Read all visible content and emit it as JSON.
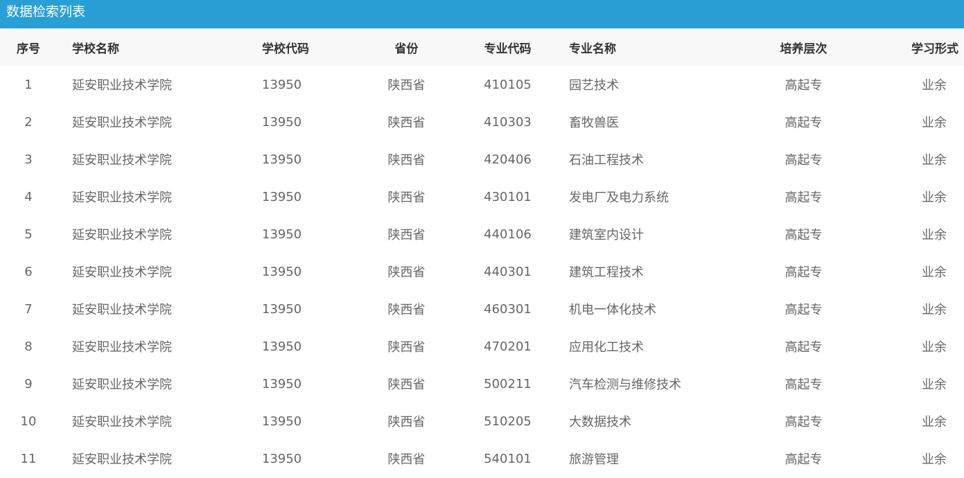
{
  "panel": {
    "title": "数据检索列表"
  },
  "columns": {
    "index": "序号",
    "school_name": "学校名称",
    "school_code": "学校代码",
    "province": "省份",
    "major_code": "专业代码",
    "major_name": "专业名称",
    "level": "培养层次",
    "study_form": "学习形式"
  },
  "rows": [
    {
      "index": "1",
      "school_name": "延安职业技术学院",
      "school_code": "13950",
      "province": "陕西省",
      "major_code": "410105",
      "major_name": "园艺技术",
      "level": "高起专",
      "study_form": "业余"
    },
    {
      "index": "2",
      "school_name": "延安职业技术学院",
      "school_code": "13950",
      "province": "陕西省",
      "major_code": "410303",
      "major_name": "畜牧兽医",
      "level": "高起专",
      "study_form": "业余"
    },
    {
      "index": "3",
      "school_name": "延安职业技术学院",
      "school_code": "13950",
      "province": "陕西省",
      "major_code": "420406",
      "major_name": "石油工程技术",
      "level": "高起专",
      "study_form": "业余"
    },
    {
      "index": "4",
      "school_name": "延安职业技术学院",
      "school_code": "13950",
      "province": "陕西省",
      "major_code": "430101",
      "major_name": "发电厂及电力系统",
      "level": "高起专",
      "study_form": "业余"
    },
    {
      "index": "5",
      "school_name": "延安职业技术学院",
      "school_code": "13950",
      "province": "陕西省",
      "major_code": "440106",
      "major_name": "建筑室内设计",
      "level": "高起专",
      "study_form": "业余"
    },
    {
      "index": "6",
      "school_name": "延安职业技术学院",
      "school_code": "13950",
      "province": "陕西省",
      "major_code": "440301",
      "major_name": "建筑工程技术",
      "level": "高起专",
      "study_form": "业余"
    },
    {
      "index": "7",
      "school_name": "延安职业技术学院",
      "school_code": "13950",
      "province": "陕西省",
      "major_code": "460301",
      "major_name": "机电一体化技术",
      "level": "高起专",
      "study_form": "业余"
    },
    {
      "index": "8",
      "school_name": "延安职业技术学院",
      "school_code": "13950",
      "province": "陕西省",
      "major_code": "470201",
      "major_name": "应用化工技术",
      "level": "高起专",
      "study_form": "业余"
    },
    {
      "index": "9",
      "school_name": "延安职业技术学院",
      "school_code": "13950",
      "province": "陕西省",
      "major_code": "500211",
      "major_name": "汽车检测与维修技术",
      "level": "高起专",
      "study_form": "业余"
    },
    {
      "index": "10",
      "school_name": "延安职业技术学院",
      "school_code": "13950",
      "province": "陕西省",
      "major_code": "510205",
      "major_name": "大数据技术",
      "level": "高起专",
      "study_form": "业余"
    },
    {
      "index": "11",
      "school_name": "延安职业技术学院",
      "school_code": "13950",
      "province": "陕西省",
      "major_code": "540101",
      "major_name": "旅游管理",
      "level": "高起专",
      "study_form": "业余"
    }
  ],
  "colors": {
    "title_bar_bg": "#2a9fd6",
    "title_text": "#ffffff",
    "header_bg": "#f8f8f8",
    "header_text": "#333333",
    "cell_text": "#666666"
  }
}
